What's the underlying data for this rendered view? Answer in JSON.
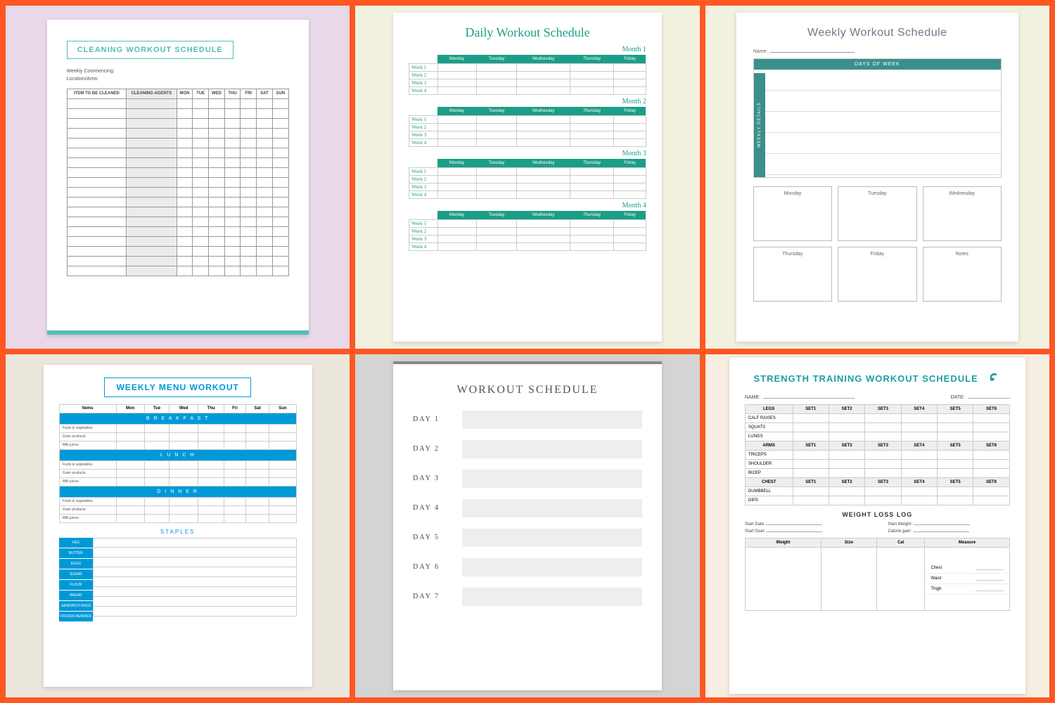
{
  "templates": {
    "cleaning": {
      "title": "CLEANING WORKOUT SCHEDULE",
      "meta1": "Weekly Commencing:",
      "meta2": "Location/Area:",
      "headers": [
        "ITEM TO BE CLEANED",
        "CLEANING AGENTS",
        "MON",
        "TUE",
        "WED",
        "THU",
        "FRI",
        "SAT",
        "SUN"
      ]
    },
    "daily": {
      "title": "Daily Workout Schedule",
      "months": [
        "Month 1",
        "Month 2",
        "Month 3",
        "Month 4"
      ],
      "days": [
        "Monday",
        "Tuesday",
        "Wednesday",
        "Thursday",
        "Friday"
      ],
      "weeks": [
        "Week 1",
        "Week 2",
        "Week 3",
        "Week 4"
      ]
    },
    "weekly": {
      "title": "Weekly Workout Schedule",
      "name_label": "Name:",
      "top_bar": "DAYS OF WEEK",
      "side_bar": "WEEKLY DETAILS",
      "day_boxes": [
        "Monday",
        "Tuesday",
        "Wednesday",
        "Thursday",
        "Friday",
        "Notes"
      ]
    },
    "menu": {
      "title": "WEEKLY MENU WORKOUT",
      "day_headers": [
        "Items",
        "Mon",
        "Tue",
        "Wed",
        "Thu",
        "Fri",
        "Sat",
        "Sun"
      ],
      "sections": [
        "B R E A K F A S T",
        "L U N C H",
        "D I N N E R"
      ],
      "items": [
        "Fruits & vegetables",
        "Grain products",
        "Milk juices"
      ],
      "staples_title": "STAPLES",
      "staples": [
        "VEG",
        "BUTTER",
        "EGGS",
        "SUGAR",
        "FLOUR",
        "BREAD",
        "SANDWICH BAGS",
        "FROZEN BERRIES"
      ]
    },
    "simple": {
      "title": "WORKOUT SCHEDULE",
      "days": [
        "DAY 1",
        "DAY 2",
        "DAY 3",
        "DAY 4",
        "DAY 5",
        "DAY 6",
        "DAY 7"
      ]
    },
    "strength": {
      "title": "STRENGTH TRAINING WORKOUT SCHEDULE",
      "name_label": "NAME:",
      "date_label": "DATE:",
      "sets": [
        "SET1",
        "SET2",
        "SET3",
        "SET4",
        "SET5",
        "SET6"
      ],
      "groups": [
        {
          "cat": "LEGS",
          "rows": [
            "CALF RAISES",
            "SQUATS",
            "LUNGS"
          ]
        },
        {
          "cat": "ARMS",
          "rows": [
            "TRICEPS",
            "SHOULDER",
            "BICEP"
          ]
        },
        {
          "cat": "CHEST",
          "rows": [
            "DUMBBELL",
            "DIPS"
          ]
        }
      ],
      "sub_title": "WEIGHT LOSS LOG",
      "loss_meta": [
        "Start Date:",
        "Start Weight:",
        "Start Goal:",
        "Calorie gain:"
      ],
      "log_headers": [
        "Weight",
        "Size",
        "Cal",
        "Measure"
      ],
      "measures": [
        "Chest",
        "Waist",
        "Thigh"
      ]
    }
  }
}
